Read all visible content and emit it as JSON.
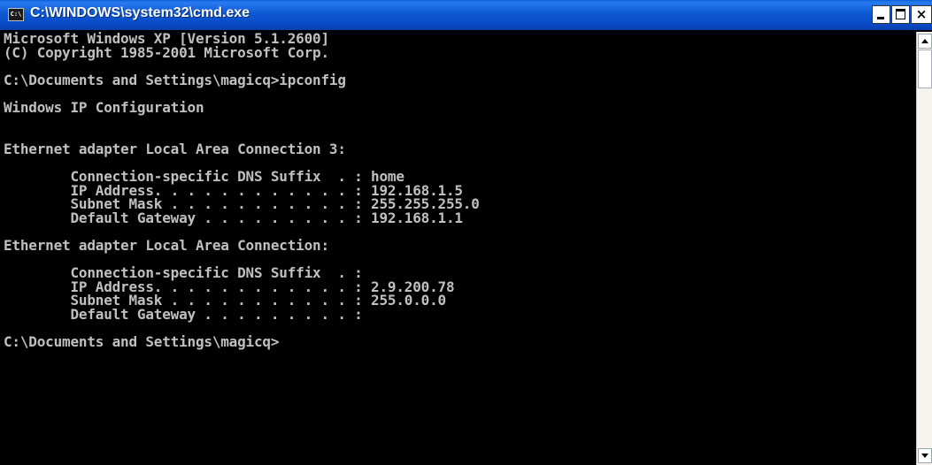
{
  "window": {
    "title": "C:\\WINDOWS\\system32\\cmd.exe",
    "icon_label": "C:\\",
    "minimize_icon": "minimize-icon",
    "maximize_icon": "maximize-icon",
    "close_icon": "close-icon",
    "close_glyph": "×"
  },
  "console": {
    "lines": [
      "Microsoft Windows XP [Version 5.1.2600]",
      "(C) Copyright 1985-2001 Microsoft Corp.",
      "",
      "C:\\Documents and Settings\\magicq>ipconfig",
      "",
      "Windows IP Configuration",
      "",
      "",
      "Ethernet adapter Local Area Connection 3:",
      "",
      "        Connection-specific DNS Suffix  . : home",
      "        IP Address. . . . . . . . . . . . : 192.168.1.5",
      "        Subnet Mask . . . . . . . . . . . : 255.255.255.0",
      "        Default Gateway . . . . . . . . . : 192.168.1.1",
      "",
      "Ethernet adapter Local Area Connection:",
      "",
      "        Connection-specific DNS Suffix  . :",
      "        IP Address. . . . . . . . . . . . : 2.9.200.78",
      "        Subnet Mask . . . . . . . . . . . : 255.0.0.0",
      "        Default Gateway . . . . . . . . . :",
      "",
      "C:\\Documents and Settings\\magicq>"
    ]
  },
  "colors": {
    "console_bg": "#000000",
    "console_text": "#c0c0c0",
    "titlebar": "#0a56d0"
  }
}
